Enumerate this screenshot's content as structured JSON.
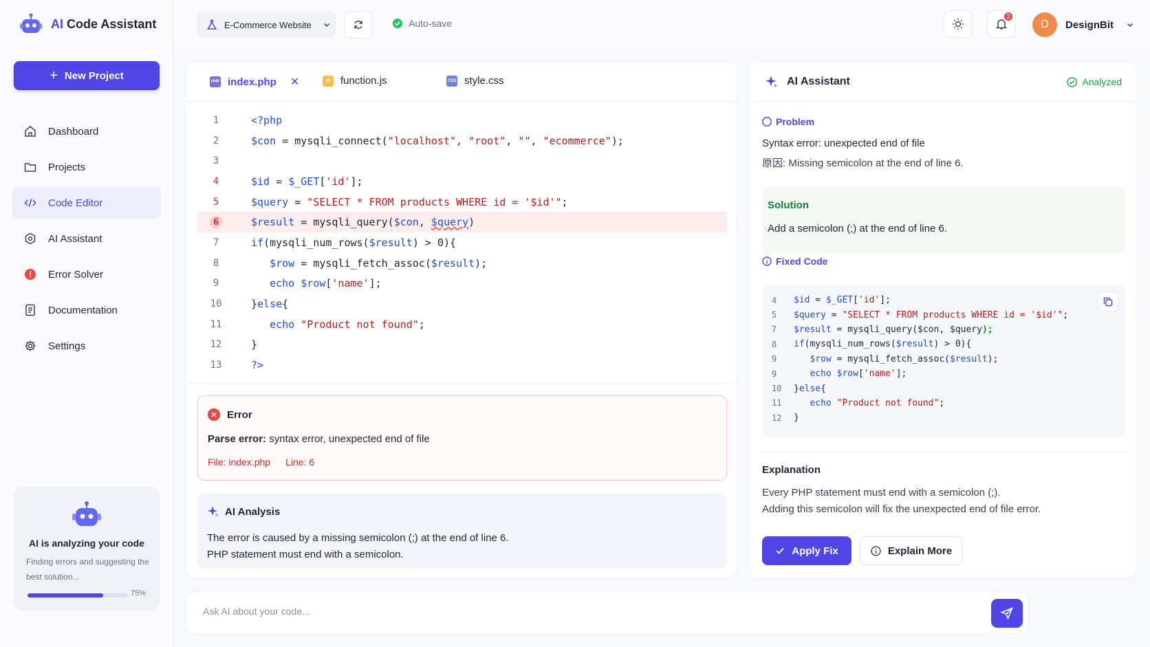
{
  "app": {
    "title_ai": "AI",
    "title_rest": "Code Assistant"
  },
  "sidebar": {
    "new_project": "New Project",
    "items": [
      {
        "label": "Dashboard",
        "icon": "home-icon"
      },
      {
        "label": "Projects",
        "icon": "folder-icon"
      },
      {
        "label": "Code Editor",
        "icon": "code-icon",
        "active": true
      },
      {
        "label": "AI Assistant",
        "icon": "ai-chip-icon"
      },
      {
        "label": "Error Solver",
        "icon": "error-icon"
      },
      {
        "label": "Documentation",
        "icon": "document-icon"
      },
      {
        "label": "Settings",
        "icon": "gear-icon"
      }
    ],
    "ai_card": {
      "title": "AI is analyzing your code",
      "subtitle": "Finding errors and suggesting the best solution...",
      "progress": 75,
      "progress_label": "75%"
    }
  },
  "topbar": {
    "project": "E-Commerce Website",
    "autosave": "Auto-save",
    "notifications": "3",
    "user": {
      "initial": "D",
      "name": "DesignBit"
    }
  },
  "editor": {
    "tabs": [
      {
        "label": "index.php",
        "type": "PHP",
        "color": "#7c6fd6",
        "active": true
      },
      {
        "label": "function.js",
        "type": "JS",
        "color": "#f5c04a"
      },
      {
        "label": "style.css",
        "type": "CSS",
        "color": "#6d83d8"
      }
    ],
    "error": {
      "title": "Error",
      "message_bold": "Parse error:",
      "message": " syntax error, unexpected end of file",
      "file_label": "File:",
      "file": "index.php",
      "line_label": "Line:",
      "line": "6"
    },
    "analysis": {
      "title": "AI Analysis",
      "line1": "The error is caused by a missing semicolon (;) at the end of line 6.",
      "line2": "PHP statement must end with a semicolon."
    }
  },
  "ask": {
    "placeholder": "Ask AI about your code..."
  },
  "assistant": {
    "title": "AI Assistant",
    "status": "Analyzed",
    "problem_label": "Problem",
    "problem_text": "Syntax error: unexpected end of file",
    "problem_cause": "原因: Missing semicolon at the end of line 6.",
    "solution_label": "Solution",
    "solution_text": "Add a semicolon (;) at the end of line 6.",
    "fixed_label": "Fixed Code",
    "explanation_title": "Explanation",
    "explanation_1": "Every PHP statement must end with a semicolon (;).",
    "explanation_2": "Adding this semicolon will fix the unexpected end of file error.",
    "apply": "Apply Fix",
    "explain": "Explain More"
  },
  "colors": {
    "accent": "#4f46e5",
    "error": "#ef4444",
    "success": "#16a34a"
  }
}
